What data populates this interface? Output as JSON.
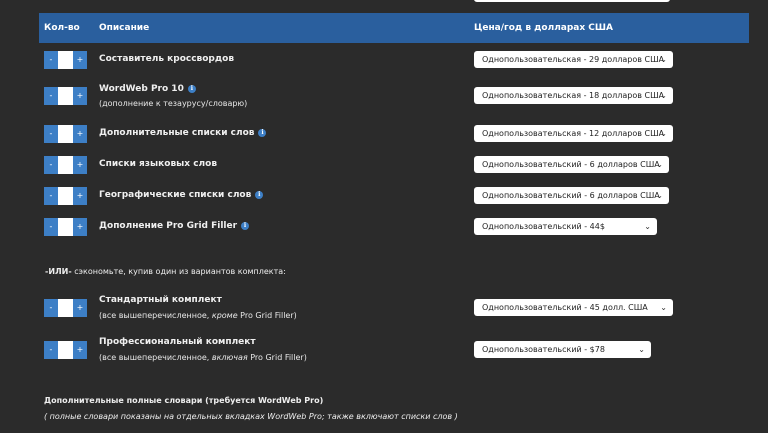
{
  "header": {
    "qty": "Кол-во",
    "desc": "Описание",
    "price": "Цена/год в долларах США"
  },
  "stepper": {
    "minus": "-",
    "plus": "+"
  },
  "items": [
    {
      "label": "Составитель кроссвордов",
      "price": "Однопользовательская - 29 долларов США"
    },
    {
      "label": "WordWeb Pro 10",
      "sub": "(дополнение к тезаурусу/словарю)",
      "price": "Однопользовательская - 18 долларов США"
    },
    {
      "label": "Дополнительные списки слов",
      "price": "Однопользовательская - 12 долларов США"
    },
    {
      "label": "Списки языковых слов",
      "price": "Однопользовательский - 6 долларов США"
    },
    {
      "label": "Географические списки слов",
      "price": "Однопользовательский - 6 долларов США"
    },
    {
      "label": "Дополнение Pro Grid Filler",
      "price": "Однопользовательский - 44$"
    }
  ],
  "or_line": {
    "bold": "-ИЛИ-",
    "text": " сэкономьте, купив один из вариантов комплекта:"
  },
  "bundles": [
    {
      "label": "Стандартный комплект",
      "sub_pre": "(все вышеперечисленное, ",
      "sub_em": "кроме",
      "sub_post": " Pro Grid Filler)",
      "price": "Однопользовательский - 45 долл. США"
    },
    {
      "label": "Профессиональный комплект",
      "sub_pre": "(все вышеперечисленное, ",
      "sub_em": "включая",
      "sub_post": " Pro Grid Filler)",
      "price": "Однопользовательский - $78"
    }
  ],
  "dictionaries": {
    "title": "Дополнительные полные словари (требуется WordWeb Pro)",
    "subtitle": "( полные словари показаны на отдельных вкладках WordWeb Pro; также включают списки слов )"
  },
  "icons": {
    "info": "info-icon",
    "dropdown": "chevron-down-icon"
  },
  "colors": {
    "header": "#2a5f9e",
    "stepper": "#3d7fc6",
    "background": "#2b2b2b"
  }
}
